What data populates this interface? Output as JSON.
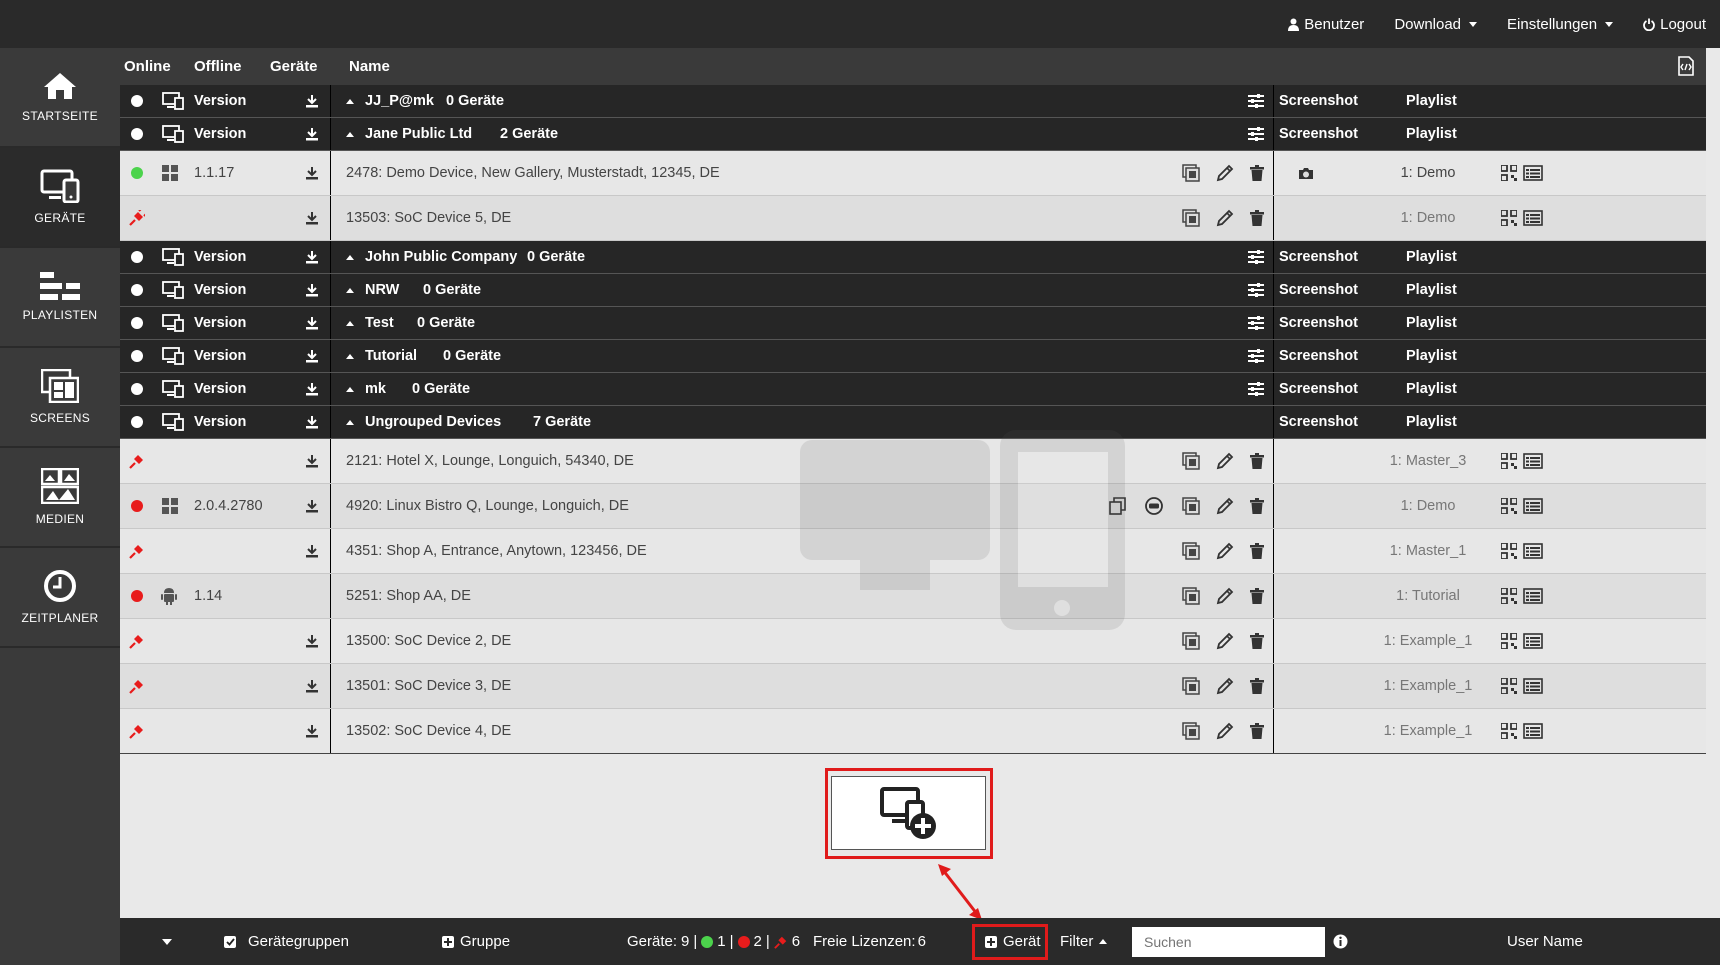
{
  "topnav": {
    "user": "Benutzer",
    "download": "Download",
    "settings": "Einstellungen",
    "logout": "Logout"
  },
  "sidebar": {
    "items": [
      {
        "label": "STARTSEITE",
        "icon": "home-icon"
      },
      {
        "label": "GERÄTE",
        "icon": "devices-icon"
      },
      {
        "label": "PLAYLISTEN",
        "icon": "playlist-icon"
      },
      {
        "label": "SCREENS",
        "icon": "screens-icon"
      },
      {
        "label": "MEDIEN",
        "icon": "media-icon"
      },
      {
        "label": "ZEITPLANER",
        "icon": "clock-icon"
      }
    ]
  },
  "columns": {
    "online": "Online",
    "offline": "Offline",
    "devices": "Geräte",
    "name": "Name"
  },
  "groups": {
    "g1": {
      "version": "Version",
      "name": "JJ_P@mk",
      "count": "0 Geräte",
      "screenshot": "Screenshot",
      "playlist": "Playlist"
    },
    "g2": {
      "version": "Version",
      "name": "Jane Public Ltd",
      "count": "2 Geräte",
      "screenshot": "Screenshot",
      "playlist": "Playlist"
    },
    "g3": {
      "version": "Version",
      "name": "John Public Company",
      "count": "0 Geräte",
      "screenshot": "Screenshot",
      "playlist": "Playlist"
    },
    "g4": {
      "version": "Version",
      "name": "NRW",
      "count": "0 Geräte",
      "screenshot": "Screenshot",
      "playlist": "Playlist"
    },
    "g5": {
      "version": "Version",
      "name": "Test",
      "count": "0 Geräte",
      "screenshot": "Screenshot",
      "playlist": "Playlist"
    },
    "g6": {
      "version": "Version",
      "name": "Tutorial",
      "count": "0 Geräte",
      "screenshot": "Screenshot",
      "playlist": "Playlist"
    },
    "g7": {
      "version": "Version",
      "name": "mk",
      "count": "0 Geräte",
      "screenshot": "Screenshot",
      "playlist": "Playlist"
    },
    "g8": {
      "version": "Version",
      "name": "Ungrouped Devices",
      "count": "7 Geräte",
      "screenshot": "Screenshot",
      "playlist": "Playlist"
    }
  },
  "devices": {
    "d1": {
      "status": "online",
      "os": "windows",
      "version": "1.1.17",
      "name": "2478: Demo Device, New Gallery, Musterstadt, 12345, DE",
      "playlist": "1: Demo"
    },
    "d2": {
      "status": "unplugged",
      "os": "",
      "version": "",
      "name": "13503: SoC Device 5, DE",
      "playlist": "1: Demo"
    },
    "d3": {
      "status": "unplugged",
      "os": "",
      "version": "",
      "name": "2121: Hotel X, Lounge, Longuich, 54340, DE",
      "playlist": "1: Master_3"
    },
    "d4": {
      "status": "offline",
      "os": "windows",
      "version": "2.0.4.2780",
      "name": "4920: Linux Bistro Q, Lounge, Longuich, DE",
      "playlist": "1: Demo"
    },
    "d5": {
      "status": "unplugged",
      "os": "",
      "version": "",
      "name": "4351: Shop A, Entrance, Anytown, 123456, DE",
      "playlist": "1: Master_1"
    },
    "d6": {
      "status": "offline",
      "os": "android",
      "version": "1.14",
      "name": "5251: Shop AA, DE",
      "playlist": "1: Tutorial"
    },
    "d7": {
      "status": "unplugged",
      "os": "",
      "version": "",
      "name": "13500: SoC Device 2, DE",
      "playlist": "1: Example_1"
    },
    "d8": {
      "status": "unplugged",
      "os": "",
      "version": "",
      "name": "13501: SoC Device 3, DE",
      "playlist": "1: Example_1"
    },
    "d9": {
      "status": "unplugged",
      "os": "",
      "version": "",
      "name": "13502: SoC Device 4, DE",
      "playlist": "1: Example_1"
    }
  },
  "bottombar": {
    "groups_toggle": "Gerätegruppen",
    "add_group": "Gruppe",
    "devices_label": "Geräte:",
    "devices_total": "9",
    "online_count": "1",
    "offline_count": "2",
    "unplugged_count": "6",
    "licenses_label": "Freie Lizenzen:",
    "licenses_count": "6",
    "add_device": "Gerät",
    "filter": "Filter",
    "search_placeholder": "Suchen",
    "username": "User Name"
  },
  "colors": {
    "online": "#4cd34c",
    "offline": "#e81c1c",
    "highlight": "#e01b1b",
    "dark": "#262626"
  }
}
